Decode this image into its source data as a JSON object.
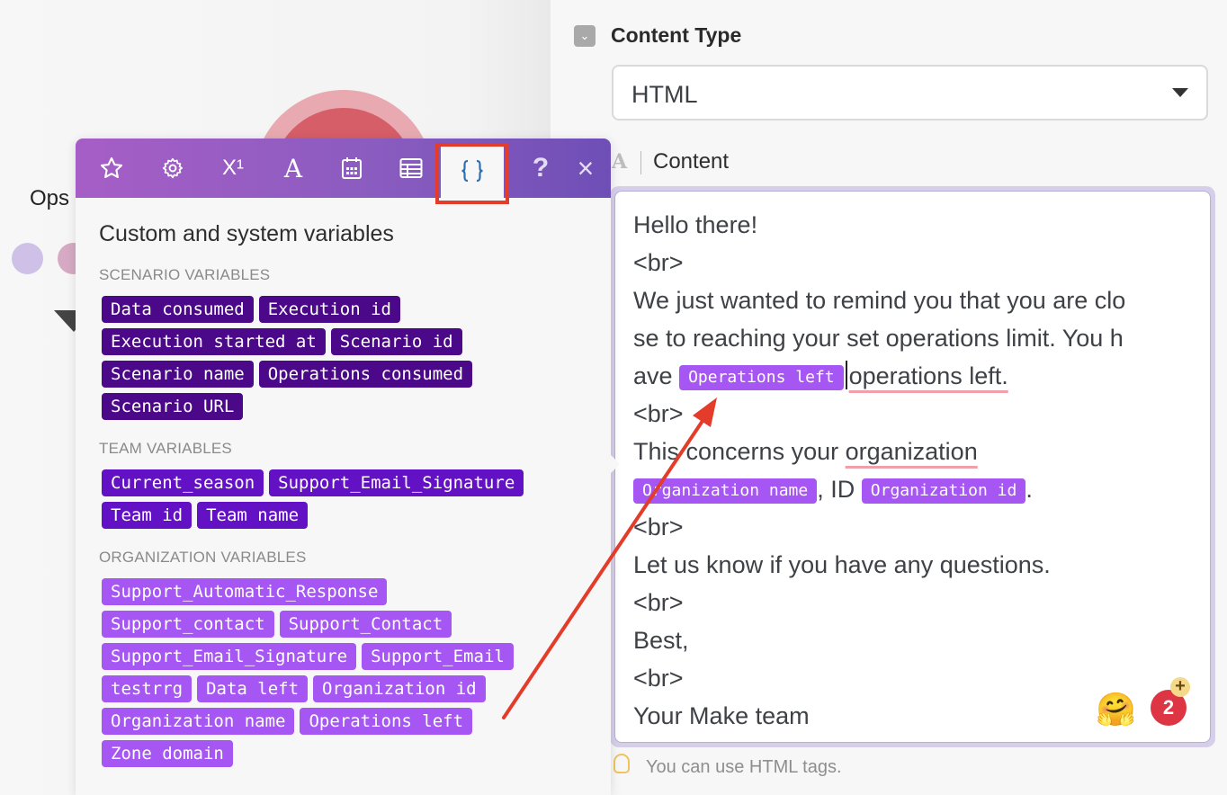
{
  "canvas": {
    "ops_label": "Ops"
  },
  "content_type": {
    "label": "Content Type",
    "selected": "HTML"
  },
  "content": {
    "label": "Content",
    "lines": [
      "Hello there!",
      "<br>",
      "We just wanted to remind you that you are clo",
      "se to reaching your set operations limit. You h",
      "ave",
      "operations left.",
      "<br>",
      "This concerns your",
      "organization",
      ", ID",
      ".",
      "<br>",
      "Let us know if you have any questions.",
      "<br>",
      "Best,",
      "<br>",
      "Your Make team"
    ],
    "pills": {
      "operations_left": "Operations left",
      "organization_name": "Organization name",
      "organization_id": "Organization id"
    },
    "hint": "You can use HTML tags.",
    "emoji": "🤗",
    "notification_count": "2",
    "notification_plus": "+"
  },
  "popup": {
    "title": "Custom and system variables",
    "tabs": [
      {
        "name": "favorites",
        "icon": "star-icon"
      },
      {
        "name": "general",
        "icon": "gear-icon"
      },
      {
        "name": "math",
        "icon": "superscript-icon",
        "label": "X¹"
      },
      {
        "name": "text",
        "icon": "text-icon",
        "label": "A"
      },
      {
        "name": "date",
        "icon": "calendar-icon"
      },
      {
        "name": "array",
        "icon": "table-icon"
      },
      {
        "name": "variables",
        "icon": "braces-icon",
        "label": "{}",
        "active": true
      },
      {
        "name": "help",
        "icon": "help-icon",
        "label": "?"
      },
      {
        "name": "close",
        "icon": "close-icon",
        "label": "×"
      }
    ],
    "sections": [
      {
        "title": "SCENARIO VARIABLES",
        "items": [
          "Data consumed",
          "Execution id",
          "Execution started at",
          "Scenario id",
          "Scenario name",
          "Operations consumed",
          "Scenario URL"
        ]
      },
      {
        "title": "TEAM VARIABLES",
        "items": [
          "Current_season",
          "Support_Email_Signature",
          "Team id",
          "Team name"
        ]
      },
      {
        "title": "ORGANIZATION VARIABLES",
        "items": [
          "Support_Automatic_Response",
          "Support_contact",
          "Support_Contact",
          "Support_Email_Signature",
          "Support_Email",
          "testrrg",
          "Data left",
          "Organization id",
          "Organization name",
          "Operations left",
          "Zone domain"
        ]
      }
    ]
  },
  "colors": {
    "scenario_tag": "#4b0889",
    "team_tag": "#6211c4",
    "org_tag": "#a556f3",
    "annotation": "#e43c2a",
    "header_start": "#a65ec6",
    "header_end": "#6e4fb6"
  }
}
